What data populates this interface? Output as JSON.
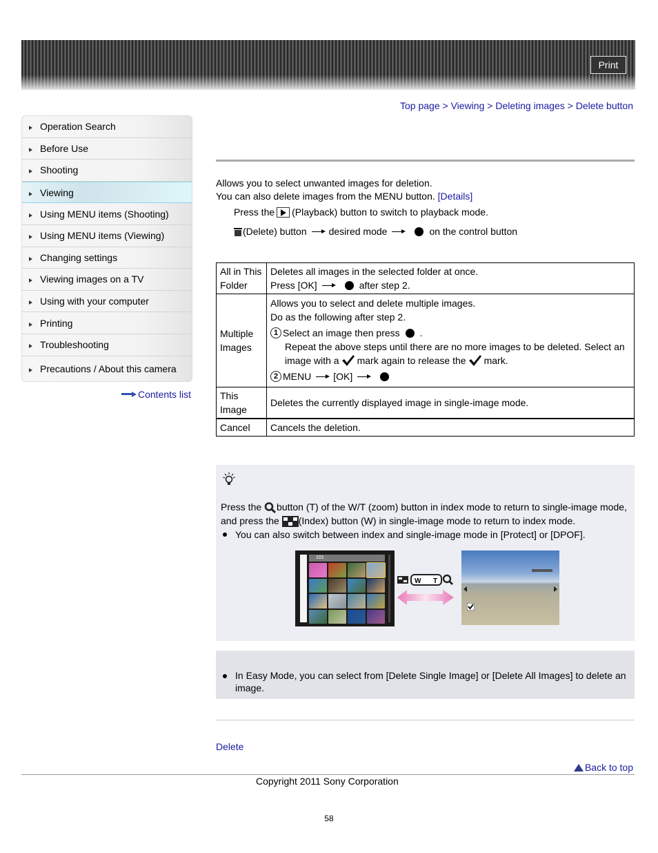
{
  "header": {
    "print_label": "Print"
  },
  "breadcrumb": {
    "items": [
      "Top page",
      "Viewing",
      "Deleting images",
      "Delete button"
    ],
    "separator": ">"
  },
  "sidebar": {
    "items": [
      {
        "label": "Operation Search",
        "active": false
      },
      {
        "label": "Before Use",
        "active": false
      },
      {
        "label": "Shooting",
        "active": false
      },
      {
        "label": "Viewing",
        "active": true
      },
      {
        "label": "Using MENU items (Shooting)",
        "active": false
      },
      {
        "label": "Using MENU items (Viewing)",
        "active": false
      },
      {
        "label": "Changing settings",
        "active": false
      },
      {
        "label": "Viewing images on a TV",
        "active": false
      },
      {
        "label": "Using with your computer",
        "active": false
      },
      {
        "label": "Printing",
        "active": false
      },
      {
        "label": "Troubleshooting",
        "active": false
      },
      {
        "label": "Precautions / About this camera",
        "active": false
      }
    ],
    "contents_link": "Contents list"
  },
  "intro": {
    "line1": "Allows you to select unwanted images for deletion.",
    "line2": "You can also delete images from the MENU button.",
    "details_link": "[Details]"
  },
  "steps": {
    "step1_pre": "Press the",
    "step1_post": "(Playback) button to switch to playback mode.",
    "step2_a": "(Delete) button",
    "step2_b": "desired mode",
    "step2_c": "on the control button"
  },
  "table": {
    "rows": [
      {
        "label": "All in This Folder",
        "line1": "Deletes all images in the selected folder at once.",
        "line2_pre": "Press [OK]",
        "line2_post": "after step 2."
      },
      {
        "label": "Multiple Images",
        "line1": "Allows you to select and delete multiple images.",
        "line2": "Do as the following after step 2.",
        "sub1_num": "1",
        "sub1": "Select an image then press",
        "sub1_end": ".",
        "sub1_detail_a": "Repeat the above steps until there are no more images to be deleted. Select an",
        "sub1_detail_b": "image with a",
        "sub1_detail_c": "mark again to release the",
        "sub1_detail_d": "mark.",
        "sub2_num": "2",
        "sub2_a": "MENU",
        "sub2_b": "[OK]"
      },
      {
        "label": "This Image",
        "line1": "Deletes the currently displayed image in single-image mode."
      },
      {
        "label": "Cancel",
        "line1": "Cancels the deletion."
      }
    ]
  },
  "hint": {
    "p1_a": "Press the",
    "p1_b": "button (T) of the W/T (zoom) button in index mode to return to single-image mode,",
    "p1_c": "and press the",
    "p1_d": "(Index) button (W) in single-image mode to return to index mode.",
    "bullet": "You can also switch between index and single-image mode in [Protect] or [DPOF].",
    "folder_label": "101",
    "wt_w": "W",
    "wt_t": "T"
  },
  "note": {
    "bullet": "In Easy Mode, you can select from [Delete Single Image] or [Delete All Images] to delete an image."
  },
  "related": {
    "link": "Delete"
  },
  "footer": {
    "back_to_top": "Back to top",
    "copyright": "Copyright 2011 Sony Corporation",
    "page_number": "58"
  }
}
